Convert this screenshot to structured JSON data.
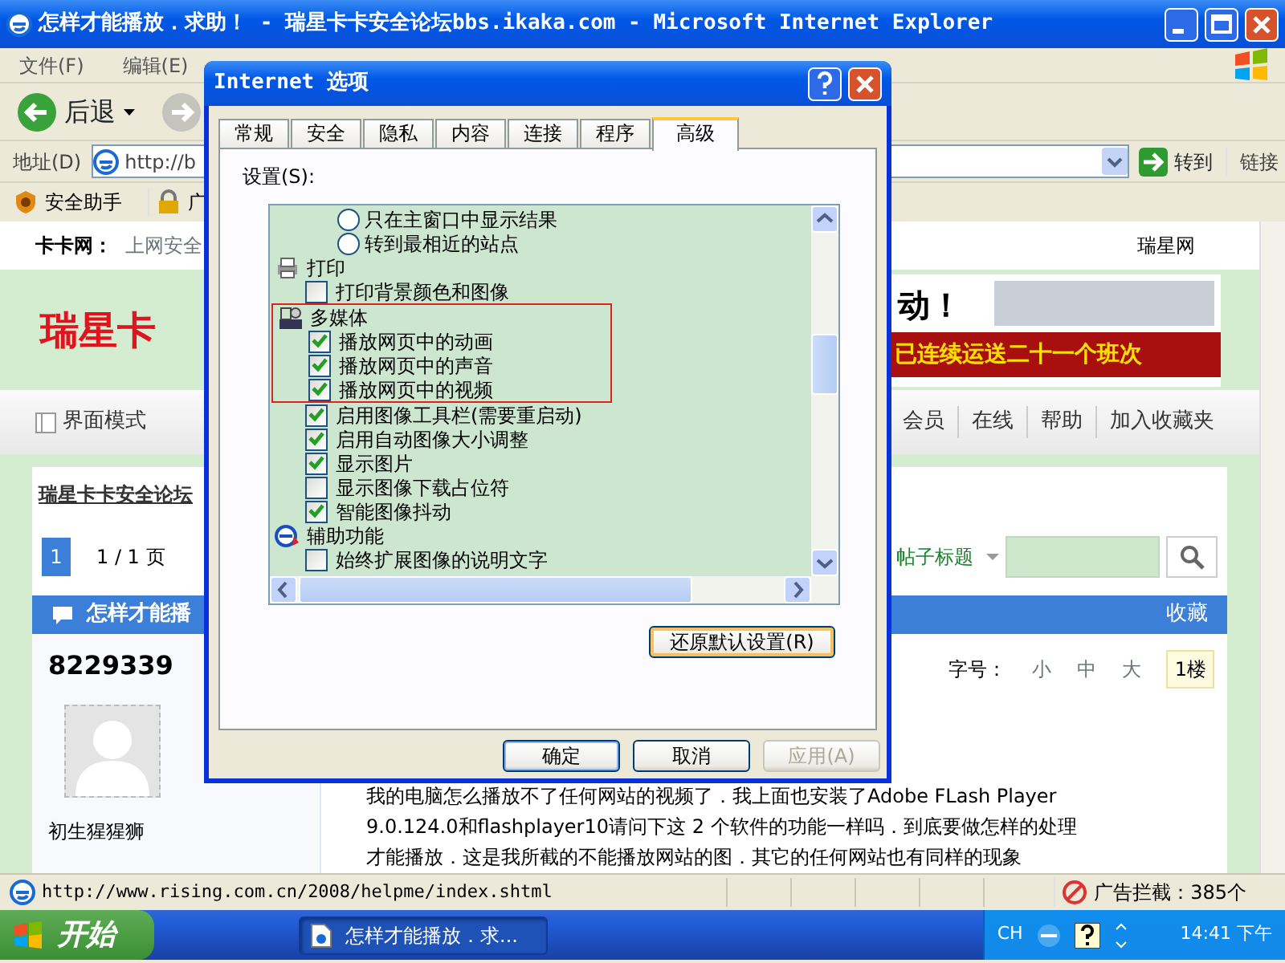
{
  "ie_window": {
    "title": "怎样才能播放．求助！ - 瑞星卡卡安全论坛bbs.ikaka.com - Microsoft Internet Explorer"
  },
  "menu": [
    "文件(F)",
    "编辑(E)"
  ],
  "toolbar": {
    "back_label": "后退"
  },
  "address_bar": {
    "label": "地址(D)",
    "value": "http://b",
    "go_label": "转到",
    "links_label": "链接"
  },
  "links_bar": [
    "安全助手",
    "广"
  ],
  "page": {
    "top_bar": {
      "site": "卡卡网：",
      "tagline": "上网安全",
      "right_link": "瑞星网"
    },
    "logo": "瑞星卡",
    "banner": {
      "headline": "动！",
      "caption": "已连续运送二十一个班次"
    },
    "nav": {
      "mode_label": "界面模式",
      "links": [
        "会员",
        "在线",
        "帮助",
        "加入收藏夹"
      ]
    },
    "breadcrumb": "瑞星卡卡安全论坛",
    "pager": {
      "current": "1",
      "summary": "1 / 1 页"
    },
    "search": {
      "scope": "帖子标题"
    },
    "thread_bar": {
      "title": "怎样才能播",
      "action": "收藏"
    },
    "post": {
      "author_id": "8229339",
      "author_name": "初生猩猩狮",
      "font_label": "字号：",
      "font_sizes": [
        "小",
        "中",
        "大"
      ],
      "floor": "1楼",
      "body_lines": [
        "我的电脑怎么播放不了任何网站的视频了．我上面也安装了Adobe FLash Player",
        "9.0.124.0和flashplayer10请问下这 2 个软件的功能一样吗．到底要做怎样的处理",
        "才能播放．这是我所截的不能播放网站的图．其它的任何网站也有同样的现象"
      ]
    }
  },
  "dialog": {
    "title": "Internet 选项",
    "tabs": [
      {
        "label": "常规",
        "selected": false
      },
      {
        "label": "安全",
        "selected": false
      },
      {
        "label": "隐私",
        "selected": false
      },
      {
        "label": "内容",
        "selected": false
      },
      {
        "label": "连接",
        "selected": false
      },
      {
        "label": "程序",
        "selected": false
      },
      {
        "label": "高级",
        "selected": true
      }
    ],
    "settings_label": "设置(S):",
    "settings": [
      {
        "kind": "radio",
        "label": "只在主窗口中显示结果",
        "selected": false,
        "highlighted": false
      },
      {
        "kind": "radio",
        "label": "转到最相近的站点",
        "selected": false,
        "highlighted": false
      },
      {
        "kind": "heading",
        "label": "打印",
        "highlighted": false
      },
      {
        "kind": "checkbox",
        "label": "打印背景颜色和图像",
        "checked": false,
        "highlighted": false
      },
      {
        "kind": "heading",
        "label": "多媒体",
        "highlighted": true
      },
      {
        "kind": "checkbox",
        "label": "播放网页中的动画",
        "checked": true,
        "highlighted": true
      },
      {
        "kind": "checkbox",
        "label": "播放网页中的声音",
        "checked": true,
        "highlighted": true
      },
      {
        "kind": "checkbox",
        "label": "播放网页中的视频",
        "checked": true,
        "highlighted": true
      },
      {
        "kind": "checkbox",
        "label": "启用图像工具栏(需要重启动)",
        "checked": true,
        "highlighted": false
      },
      {
        "kind": "checkbox",
        "label": "启用自动图像大小调整",
        "checked": true,
        "highlighted": false
      },
      {
        "kind": "checkbox",
        "label": "显示图片",
        "checked": true,
        "highlighted": false
      },
      {
        "kind": "checkbox",
        "label": "显示图像下载占位符",
        "checked": false,
        "highlighted": false
      },
      {
        "kind": "checkbox",
        "label": "智能图像抖动",
        "checked": true,
        "highlighted": false
      },
      {
        "kind": "heading",
        "label": "辅助功能",
        "highlighted": false
      },
      {
        "kind": "checkbox",
        "label": "始终扩展图像的说明文字",
        "checked": false,
        "highlighted": false
      }
    ],
    "restore_button": {
      "label": "还原默认设置(R)",
      "focused": true
    },
    "buttons": [
      {
        "label": "确定",
        "kind": "default",
        "disabled": false
      },
      {
        "label": "取消",
        "kind": "normal",
        "disabled": false
      },
      {
        "label": "应用(A)",
        "kind": "normal",
        "disabled": true
      }
    ]
  },
  "status_bar": {
    "url": "http://www.rising.com.cn/2008/helpme/index.shtml",
    "ad_block": "广告拦截：385个"
  },
  "taskbar": {
    "start": "开始",
    "tasks": [
      {
        "label": "怎样才能播放．求...",
        "selected": true
      }
    ],
    "lang": "CH",
    "clock": "14:41 下午"
  }
}
